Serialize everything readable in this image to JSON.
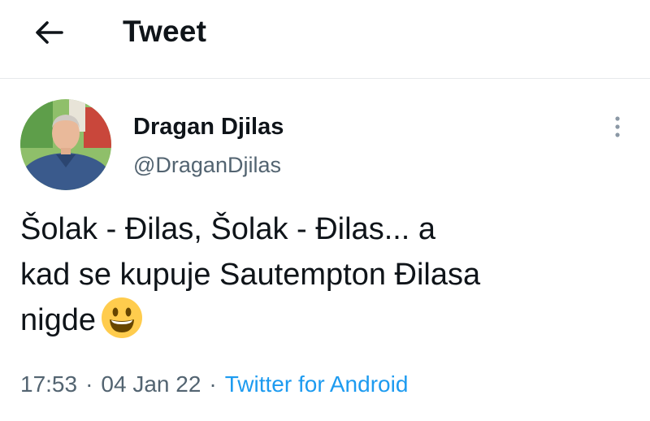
{
  "header": {
    "back_icon": "arrow-left-icon",
    "title": "Tweet"
  },
  "tweet": {
    "avatar_icon": "profile-photo",
    "display_name": "Dragan Djilas",
    "handle": "@DraganDjilas",
    "more_icon": "vertical-ellipsis-icon",
    "text_lines": [
      "Šolak - Đilas, Šolak - Đilas... a",
      "kad se kupuje Sautempton Đilasa",
      "nigde"
    ],
    "emoji": "grinning-face-emoji",
    "time": "17:53",
    "separator": "·",
    "date": "04 Jan 22",
    "source": "Twitter for Android"
  },
  "colors": {
    "text_primary": "#0f1419",
    "text_secondary": "#536471",
    "link": "#1d9bf0",
    "divider": "#e6e9eb",
    "emoji_yellow": "#ffcc4d"
  }
}
